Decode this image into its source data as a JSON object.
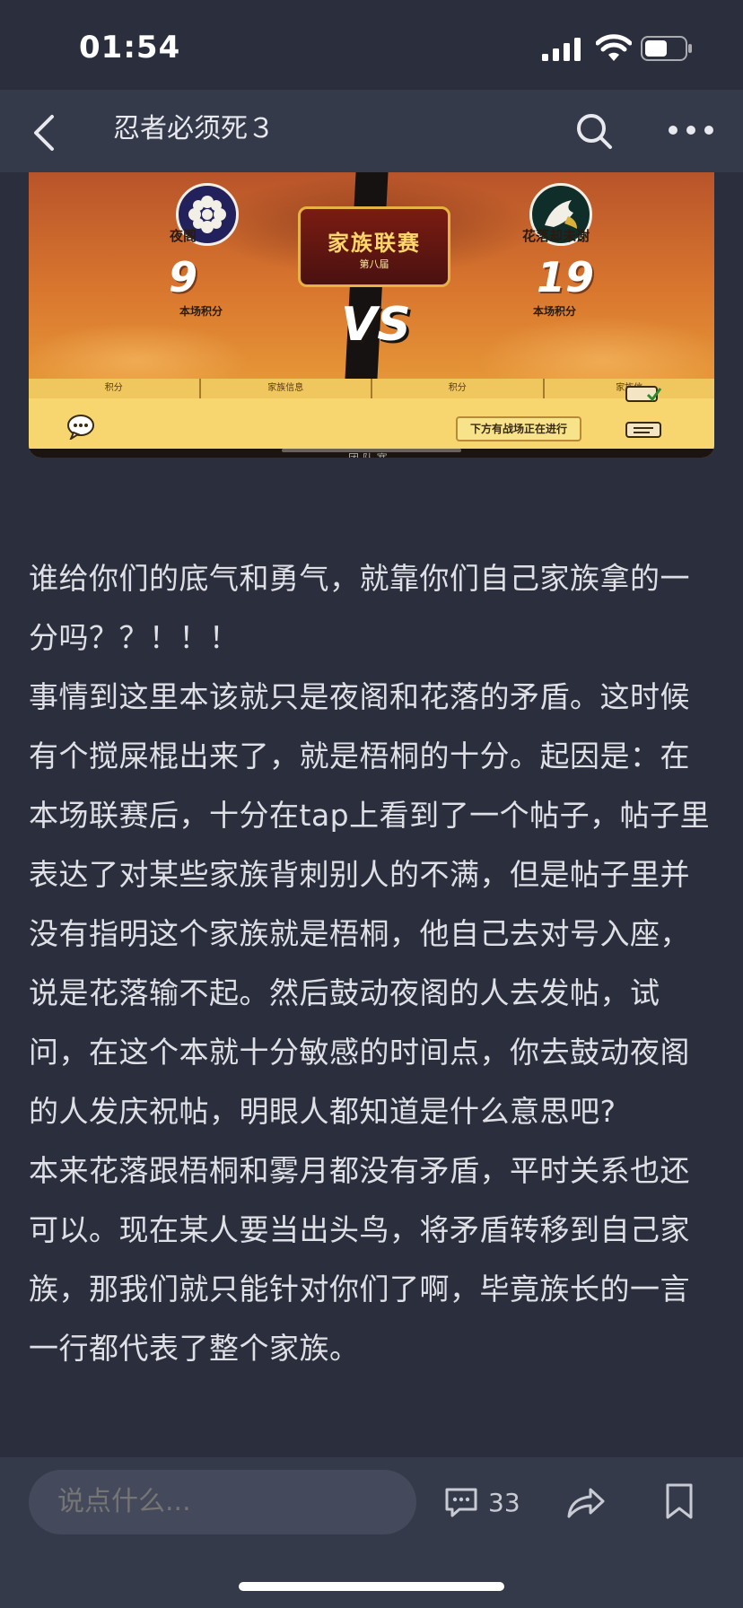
{
  "status_bar": {
    "time": "01:54"
  },
  "header": {
    "title": "忍者必须死３"
  },
  "banner": {
    "league_title": "家族联赛",
    "league_sub": "第八届",
    "left_team": {
      "name": "夜阁",
      "score": "9",
      "score_label": "本场积分"
    },
    "right_team": {
      "name": "花落却未谢",
      "score": "19",
      "score_label": "本场积分"
    },
    "vs": "VS",
    "tabs": [
      "积分",
      "家族信息",
      "积分",
      "家族信"
    ],
    "tooltip": "下方有战场正在进行",
    "overflow_text": "团 队 赛"
  },
  "article": {
    "paragraphs": [
      "谁给你们的底气和勇气，就靠你们自己家族拿的一分吗？？！！！",
      "事情到这里本该就只是夜阁和花落的矛盾。这时候有个搅屎棍出来了，就是梧桐的十分。起因是：在本场联赛后，十分在tap上看到了一个帖子，帖子里表达了对某些家族背刺别人的不满，但是帖子里并没有指明这个家族就是梧桐，他自己去对号入座，说是花落输不起。然后鼓动夜阁的人去发帖，试问，在这个本就十分敏感的时间点，你去鼓动夜阁的人发庆祝帖，明眼人都知道是什么意思吧?",
      "本来花落跟梧桐和雾月都没有矛盾，平时关系也还可以。现在某人要当出头鸟，将矛盾转移到自己家族，那我们就只能针对你们了啊，毕竟族长的一言一行都代表了整个家族。"
    ]
  },
  "bottom_bar": {
    "comment_placeholder": "说点什么...",
    "comment_count": "33"
  },
  "colors": {
    "background": "#2b2f3d",
    "header": "#353a4a",
    "text": "#dfe0e6"
  }
}
